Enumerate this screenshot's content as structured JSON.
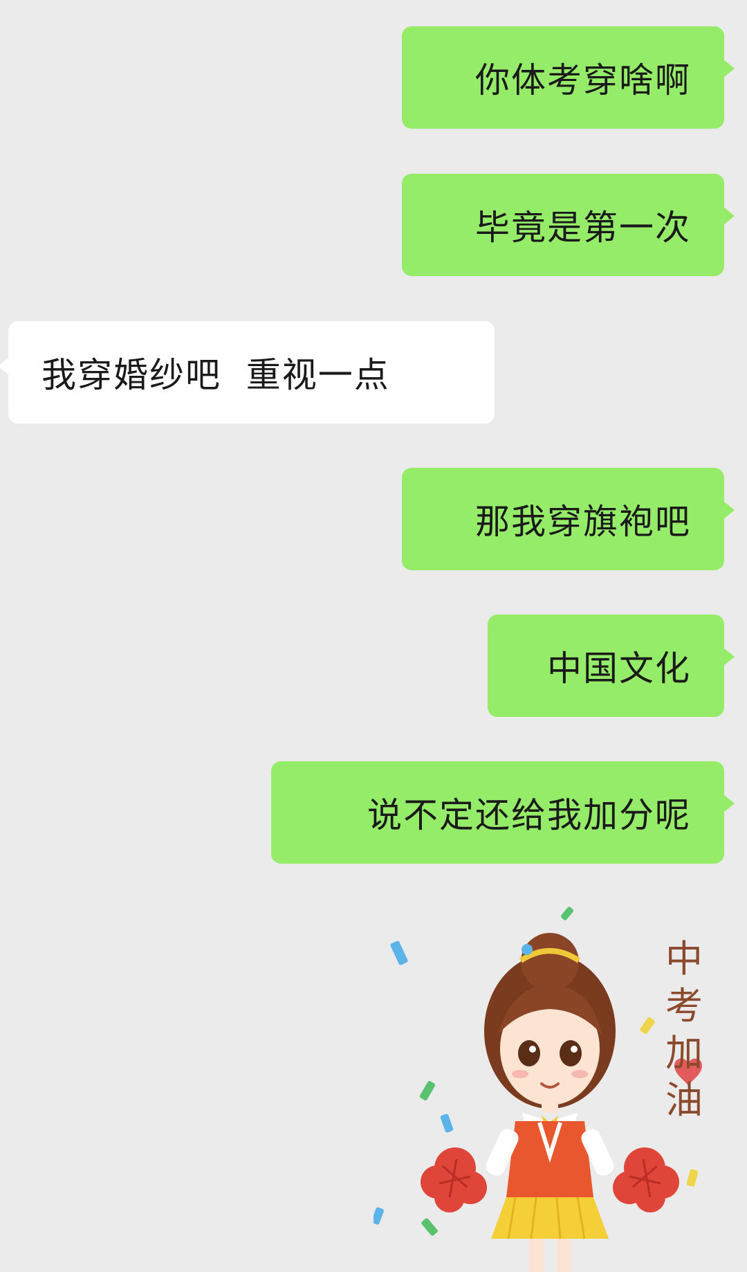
{
  "conversation": {
    "messages": [
      {
        "side": "out",
        "text": "你体考穿啥啊"
      },
      {
        "side": "out",
        "text": "毕竟是第一次"
      },
      {
        "side": "in",
        "text": "我穿婚纱吧  重视一点"
      },
      {
        "side": "out",
        "text": "那我穿旗袍吧"
      },
      {
        "side": "out",
        "text": "中国文化"
      },
      {
        "side": "out",
        "text": "说不定还给我加分呢"
      }
    ]
  },
  "sticker": {
    "characters": [
      "中",
      "考",
      "加",
      "油"
    ],
    "description": "cheerleader-girl-sticker"
  },
  "colors": {
    "background": "#ebebeb",
    "outgoing_bubble": "#95ec69",
    "incoming_bubble": "#ffffff",
    "text": "#1a1a1a",
    "sticker_text": "#8b4a2e"
  }
}
